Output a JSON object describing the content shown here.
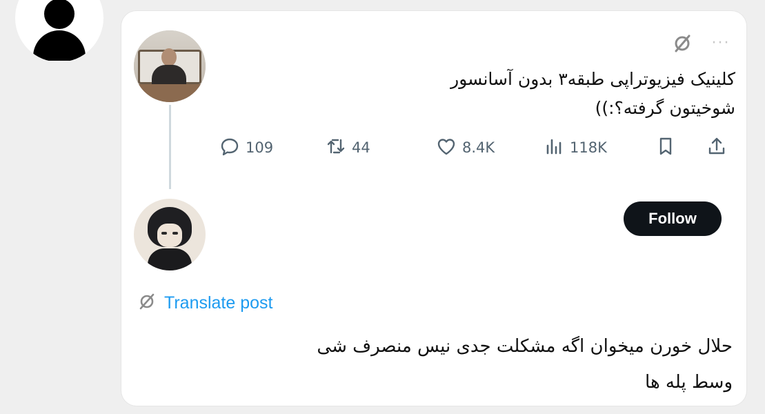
{
  "tweet": {
    "text_line1": "کلینیک فیزیوتراپی طبقه۳ بدون آسانسور",
    "text_line2": "شوخیتون گرفته؟:))",
    "stats": {
      "replies": "109",
      "retweets": "44",
      "likes": "8.4K",
      "views": "118K"
    }
  },
  "reply": {
    "follow_label": "Follow",
    "translate_label": "Translate post",
    "text_line1": "حلال خورن میخوان اگه مشکلت جدی نیس منصرف شی",
    "text_line2": "وسط پله ها"
  },
  "icons": {
    "reply": "reply-icon",
    "retweet": "retweet-icon",
    "like": "heart-icon",
    "views": "views-icon",
    "bookmark": "bookmark-icon",
    "share": "share-icon",
    "grok": "grok-icon",
    "more": "more-icon",
    "translate": "translate-icon"
  },
  "colors": {
    "text": "#0f1419",
    "muted": "#536471",
    "link": "#1d9bf0",
    "button": "#0f1419",
    "thread_line": "#cfd9de"
  }
}
